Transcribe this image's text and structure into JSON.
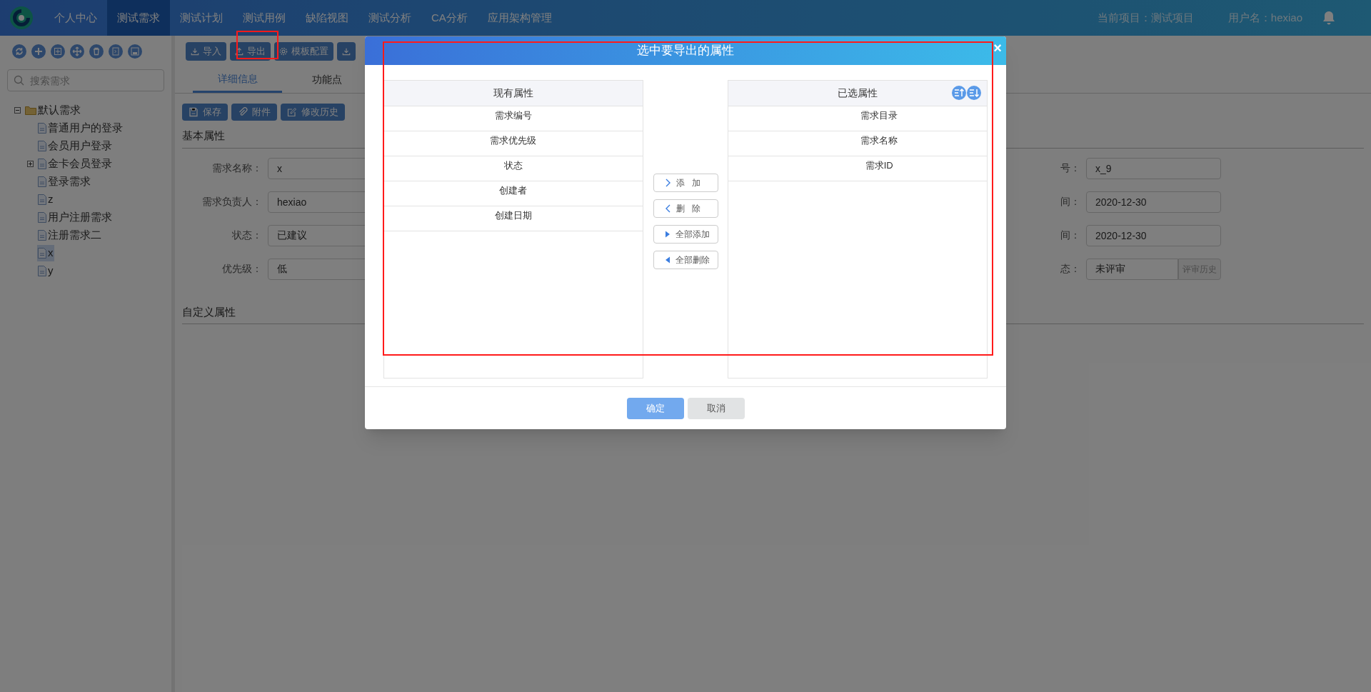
{
  "top_nav": {
    "items": [
      {
        "label": "个人中心",
        "selected": false
      },
      {
        "label": "测试需求",
        "selected": true
      },
      {
        "label": "测试计划",
        "selected": false
      },
      {
        "label": "测试用例",
        "selected": false
      },
      {
        "label": "缺陷视图",
        "selected": false
      },
      {
        "label": "测试分析",
        "selected": false
      },
      {
        "label": "CA分析",
        "selected": false
      },
      {
        "label": "应用架构管理",
        "selected": false
      }
    ],
    "project": "当前项目：测试项目",
    "user": "用户名：hexiao"
  },
  "toolbar": {
    "buttons": [
      {
        "kind": "import",
        "label": "导入"
      },
      {
        "kind": "export",
        "label": "导出"
      },
      {
        "kind": "template",
        "label": "模板配置"
      },
      {
        "kind": "import"
      }
    ]
  },
  "sidebar": {
    "search_placeholder": "搜索需求",
    "tree": [
      {
        "label": "默认需求",
        "kind": "folder",
        "expanded": true,
        "selected": false,
        "children": [
          {
            "label": "普通用户的登录",
            "kind": "file",
            "selected": false
          },
          {
            "label": "会员用户登录",
            "kind": "file",
            "selected": false
          },
          {
            "label": "金卡会员登录",
            "kind": "file",
            "expanded": false,
            "selected": false
          },
          {
            "label": "登录需求",
            "kind": "file",
            "selected": false
          },
          {
            "label": "z",
            "kind": "file",
            "selected": false
          },
          {
            "label": "用户注册需求",
            "kind": "file",
            "selected": false
          },
          {
            "label": "注册需求二",
            "kind": "file",
            "selected": false
          },
          {
            "label": "x",
            "kind": "file",
            "selected": true
          },
          {
            "label": "y",
            "kind": "file",
            "selected": false
          }
        ]
      }
    ]
  },
  "main": {
    "tabs": [
      {
        "label": "详细信息",
        "selected": true
      },
      {
        "label": "功能点",
        "selected": false
      }
    ],
    "actions": [
      {
        "kind": "save",
        "label": "保存"
      },
      {
        "kind": "attach",
        "label": "附件"
      },
      {
        "kind": "history",
        "label": "修改历史"
      }
    ],
    "basic_title": "基本属性",
    "fields_left": [
      {
        "label": "需求名称：",
        "value": "x"
      },
      {
        "label": "需求负责人：",
        "value": "hexiao"
      },
      {
        "label": "状态：",
        "value": "已建议"
      },
      {
        "label": "优先级：",
        "value": "低"
      }
    ],
    "fields_right": [
      {
        "label": "号：",
        "value": "x_9"
      },
      {
        "label": "间：",
        "value": "2020-12-30"
      },
      {
        "label": "间：",
        "value": "2020-12-30"
      },
      {
        "label": "态：",
        "value": "未评审",
        "button": "评审历史"
      }
    ],
    "custom_title": "自定义属性"
  },
  "dialog": {
    "title": "选中要导出的属性",
    "close": "×",
    "available": {
      "header": "现有属性",
      "items": [
        "需求编号",
        "需求优先级",
        "状态",
        "创建者",
        "创建日期"
      ]
    },
    "chosen": {
      "header": "已选属性",
      "items": [
        "需求目录",
        "需求名称",
        "需求ID"
      ]
    },
    "moves": [
      {
        "kind": "add",
        "label": "添加"
      },
      {
        "kind": "remove",
        "label": "删除"
      },
      {
        "kind": "add_all",
        "label": "全部添加"
      },
      {
        "kind": "remove_all",
        "label": "全部删除"
      }
    ],
    "confirm": "确定",
    "cancel": "取消"
  }
}
